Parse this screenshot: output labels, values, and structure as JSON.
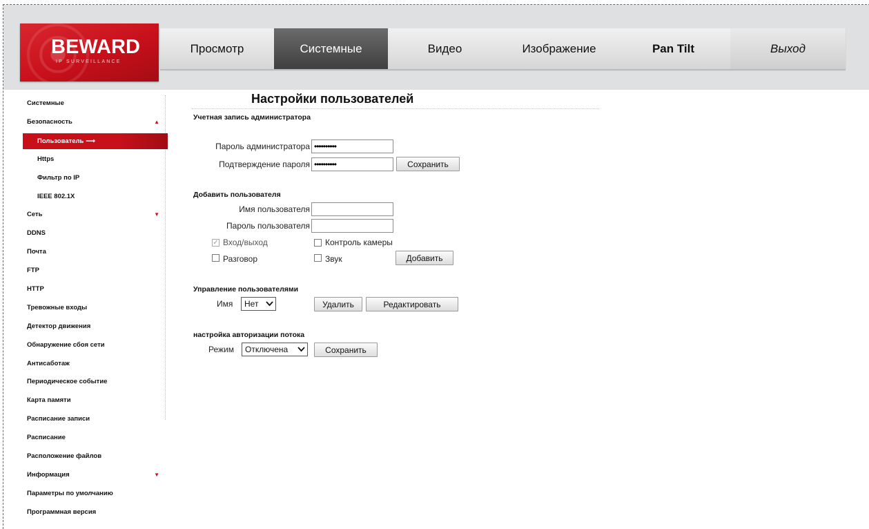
{
  "logo": {
    "brand": "BEWARD",
    "tagline": "IP SURVEILLANCE"
  },
  "nav": {
    "items": [
      {
        "label": "Просмотр"
      },
      {
        "label": "Системные"
      },
      {
        "label": "Видео"
      },
      {
        "label": "Изображение"
      },
      {
        "label": "Pan Tilt"
      },
      {
        "label": "Выход"
      }
    ],
    "active": "Системные"
  },
  "sidebar": {
    "items": [
      {
        "label": "Системные"
      },
      {
        "label": "Безопасность"
      },
      {
        "label": "Пользователь"
      },
      {
        "label": "Https"
      },
      {
        "label": "Фильтр по IP"
      },
      {
        "label": "IEEE 802.1X"
      },
      {
        "label": "Сеть"
      },
      {
        "label": "DDNS"
      },
      {
        "label": "Почта"
      },
      {
        "label": "FTP"
      },
      {
        "label": "HTTP"
      },
      {
        "label": "Тревожные входы"
      },
      {
        "label": "Детектор движения"
      },
      {
        "label": "Обнаружение сбоя сети"
      },
      {
        "label": "Антисаботаж"
      },
      {
        "label": "Периодическое событие"
      },
      {
        "label": "Карта памяти"
      },
      {
        "label": "Расписание записи"
      },
      {
        "label": "Расписание"
      },
      {
        "label": "Расположение файлов"
      },
      {
        "label": "Информация"
      },
      {
        "label": "Параметры по умолчанию"
      },
      {
        "label": "Программная версия"
      }
    ]
  },
  "page": {
    "title": "Настройки пользователей"
  },
  "admin": {
    "section_title": "Учетная запись администратора",
    "password_label": "Пароль администратора",
    "password_value": "••••••••••",
    "confirm_label": "Подтверждение пароля",
    "confirm_value": "••••••••••",
    "save_label": "Сохранить"
  },
  "add_user": {
    "section_title": "Добавить пользователя",
    "username_label": "Имя пользователя",
    "username_value": "",
    "password_label": "Пароль пользователя",
    "password_value": "",
    "perms": [
      {
        "label": "Вход/выход",
        "checked": true,
        "disabled": true
      },
      {
        "label": "Контроль камеры",
        "checked": false
      },
      {
        "label": "Разговор",
        "checked": false
      },
      {
        "label": "Звук",
        "checked": false
      }
    ],
    "add_label": "Добавить"
  },
  "manage": {
    "section_title": "Управление пользователями",
    "name_label": "Имя",
    "name_selected": "Нет",
    "delete_label": "Удалить",
    "edit_label": "Редактировать"
  },
  "stream_auth": {
    "section_title": "настройка авторизации потока",
    "mode_label": "Режим",
    "mode_selected": "Отключена",
    "save_label": "Сохранить"
  },
  "colors": {
    "accent": "#c8101b",
    "nav_active": "#4f4f4f",
    "header_bg": "#dfe0e1"
  }
}
